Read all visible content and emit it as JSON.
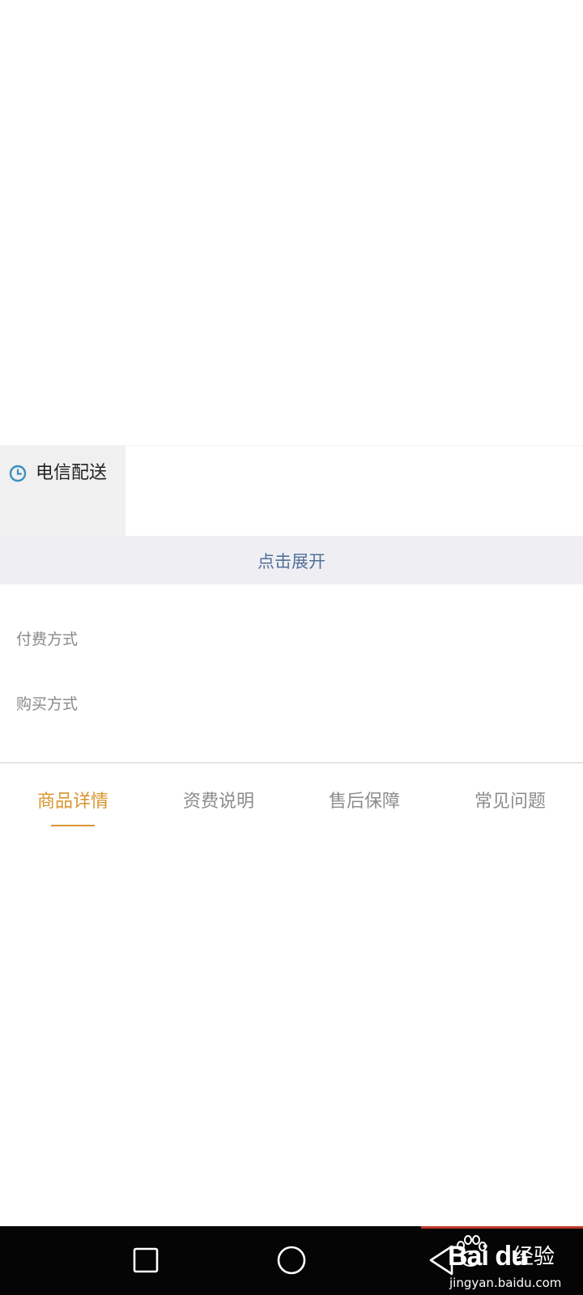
{
  "delivery": {
    "icon": "clock-icon",
    "label": "电信配送"
  },
  "expand": {
    "label": "点击展开"
  },
  "info_rows": {
    "payment": "付费方式",
    "purchase": "购买方式"
  },
  "tabs": [
    {
      "label": "商品详情",
      "active": true
    },
    {
      "label": "资费说明",
      "active": false
    },
    {
      "label": "售后保障",
      "active": false
    },
    {
      "label": "常见问题",
      "active": false
    }
  ],
  "nav": {
    "recent_icon": "square-recents-icon",
    "home_icon": "circle-home-icon",
    "back_icon": "triangle-back-icon"
  },
  "watermark": {
    "brand": "Bai du",
    "product": "经验",
    "url": "jingyan.baidu.com"
  },
  "colors": {
    "active_tab": "#d8962e",
    "inactive_tab": "#8c8c8c",
    "expand_text": "#52709a",
    "expand_bg": "#efeff3",
    "delivery_tag_bg": "#f0f0f0",
    "clock_icon": "#3a8fc4",
    "nav_bar": "#050505",
    "nav_accent": "#c0392b"
  }
}
